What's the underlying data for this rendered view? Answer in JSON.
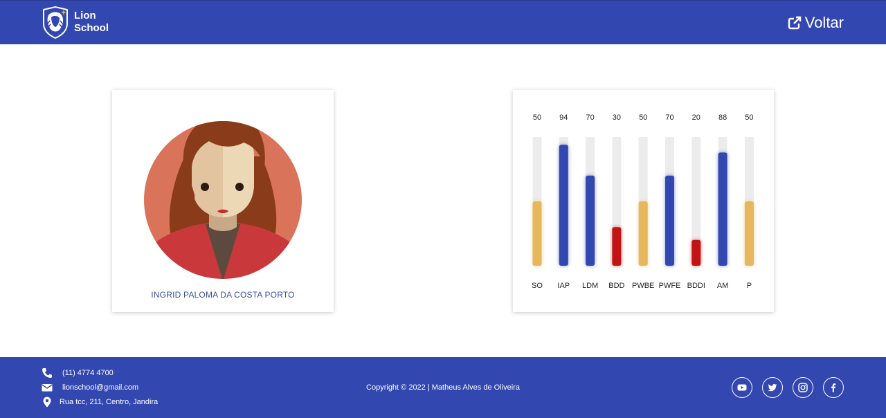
{
  "header": {
    "brand_line1": "Lion",
    "brand_line2": "School",
    "back_label": "Voltar",
    "background": "#3347b0"
  },
  "student": {
    "name": "INGRID PALOMA DA COSTA PORTO"
  },
  "chart_data": {
    "type": "bar",
    "categories": [
      "SO",
      "IAP",
      "LDM",
      "BDD",
      "PWBE",
      "PWFE",
      "BDDI",
      "AM",
      "P"
    ],
    "values": [
      50,
      94,
      70,
      30,
      50,
      70,
      20,
      88,
      50
    ],
    "ylim": [
      0,
      100
    ],
    "grid": false,
    "colors": {
      "track": "#ececec",
      "low": "#c21414",
      "medium": "#e6b75c",
      "high": "#3347b0"
    }
  },
  "footer": {
    "phone": "(11) 4774 4700",
    "email": "lionschool@gmail.com",
    "address": "Rua tcc, 211, Centro, Jandira",
    "copyright": "Copyright © 2022 | Matheus Alves de Oliveira",
    "socials": [
      "youtube-icon",
      "twitter-icon",
      "instagram-icon",
      "facebook-icon"
    ]
  }
}
